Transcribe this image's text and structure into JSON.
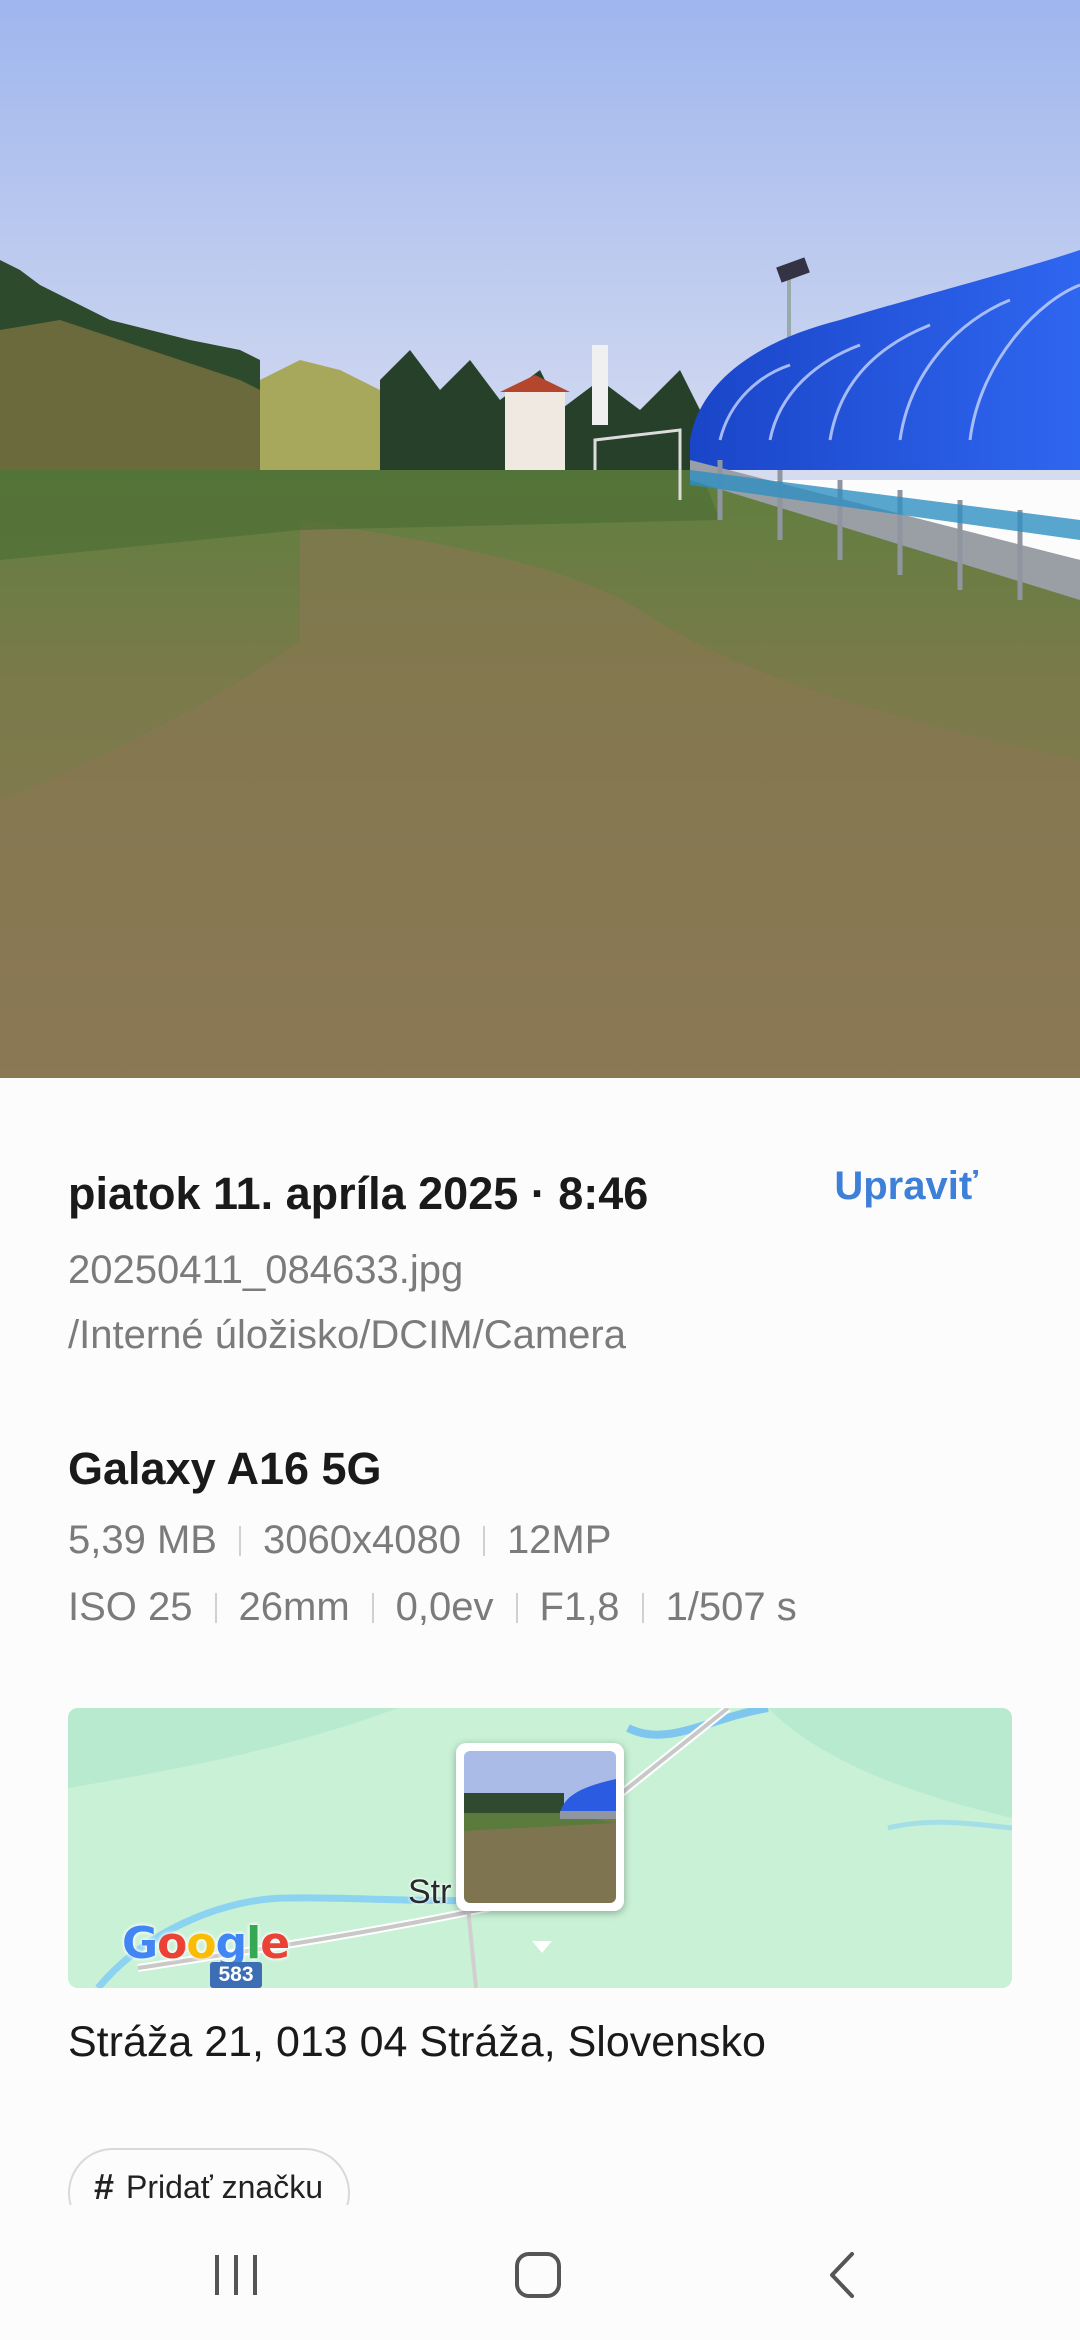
{
  "photo": {
    "icon": "landscape-photo"
  },
  "details": {
    "date_time": "piatok 11. apríla 2025 · 8:46",
    "edit_label": "Upraviť",
    "filename": "20250411_084633.jpg",
    "path": "/Interné úložisko/DCIM/Camera",
    "device": "Galaxy A16 5G",
    "file_info": [
      "5,39 MB",
      "3060x4080",
      "12MP"
    ],
    "camera_info": [
      "ISO 25",
      "26mm",
      "0,0ev",
      "F1,8",
      "1/507 s"
    ]
  },
  "map": {
    "provider": "Google",
    "road_number": "583",
    "town_label": "Str"
  },
  "location": {
    "address": "Stráža 21, 013 04 Stráža, Slovensko"
  },
  "tag": {
    "icon": "hash-icon",
    "label": "Pridať značku"
  },
  "nav": {
    "recent_icon": "recent-apps-icon",
    "home_icon": "home-icon",
    "back_icon": "back-icon"
  },
  "colors": {
    "accent": "#3e7fd8",
    "map_bg": "#c8f1d6",
    "text_primary": "#1a1a1a",
    "text_secondary": "#7b7b7b"
  }
}
